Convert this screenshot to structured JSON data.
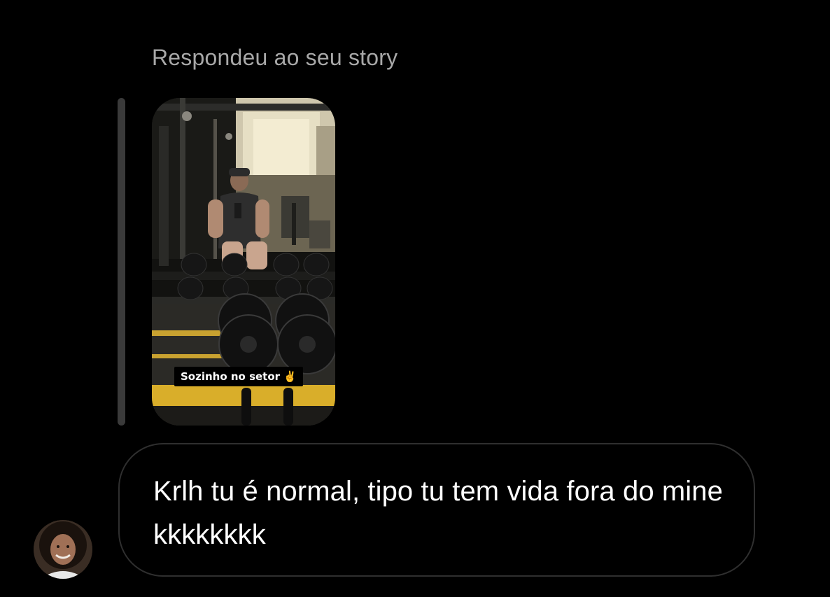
{
  "app": {
    "theme": "dark",
    "background_color": "#000000"
  },
  "reply": {
    "header_text": "Respondeu ao seu story",
    "header_color": "#a8a8a8",
    "bar_color": "#3a3a3a"
  },
  "story": {
    "image": "gym-mirror-selfie",
    "caption": "Sozinho no setor ✌️",
    "accent_color": "#f2c230"
  },
  "message": {
    "text": "Krlh tu é normal, tipo tu tem vida fora do mine kkkkkkkk",
    "text_color": "#ffffff",
    "bubble_border_color": "#2f2f2f"
  },
  "sender": {
    "avatar_icon": "user-avatar-photo"
  }
}
